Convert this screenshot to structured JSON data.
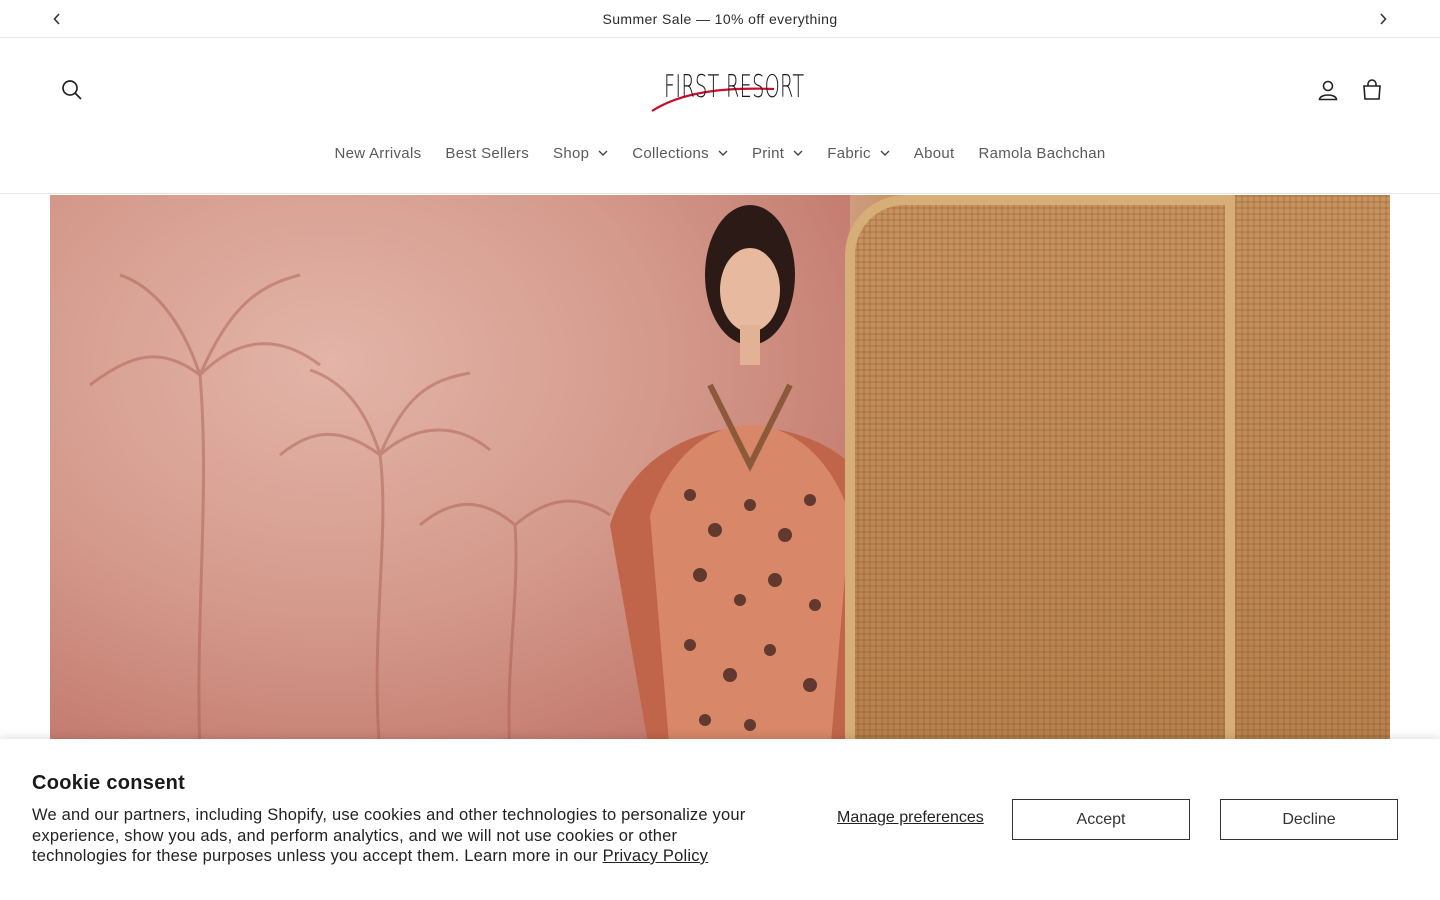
{
  "announcement": {
    "text": "Summer Sale — 10% off everything",
    "prev_icon": "chevron-left-icon",
    "next_icon": "chevron-right-icon"
  },
  "header": {
    "logo_text": "FIRST RESORT",
    "brand_accent": "#c8102e",
    "icons": [
      "search-icon",
      "account-icon",
      "cart-icon"
    ]
  },
  "nav": {
    "items": [
      {
        "label": "New Arrivals",
        "dropdown": false
      },
      {
        "label": "Best Sellers",
        "dropdown": false
      },
      {
        "label": "Shop",
        "dropdown": true
      },
      {
        "label": "Collections",
        "dropdown": true
      },
      {
        "label": "Print",
        "dropdown": true
      },
      {
        "label": "Fabric",
        "dropdown": true
      },
      {
        "label": "About",
        "dropdown": false
      },
      {
        "label": "Ramola Bachchan",
        "dropdown": false
      }
    ]
  },
  "cookie": {
    "title": "Cookie consent",
    "text": "We and our partners, including Shopify, use cookies and other technologies to personalize your experience, show you ads, and perform analytics, and we will not use cookies or other technologies for these purposes unless you accept them. Learn more in our ",
    "link_text": "Privacy Policy",
    "manage_label": "Manage preferences",
    "accept_label": "Accept",
    "decline_label": "Decline"
  }
}
